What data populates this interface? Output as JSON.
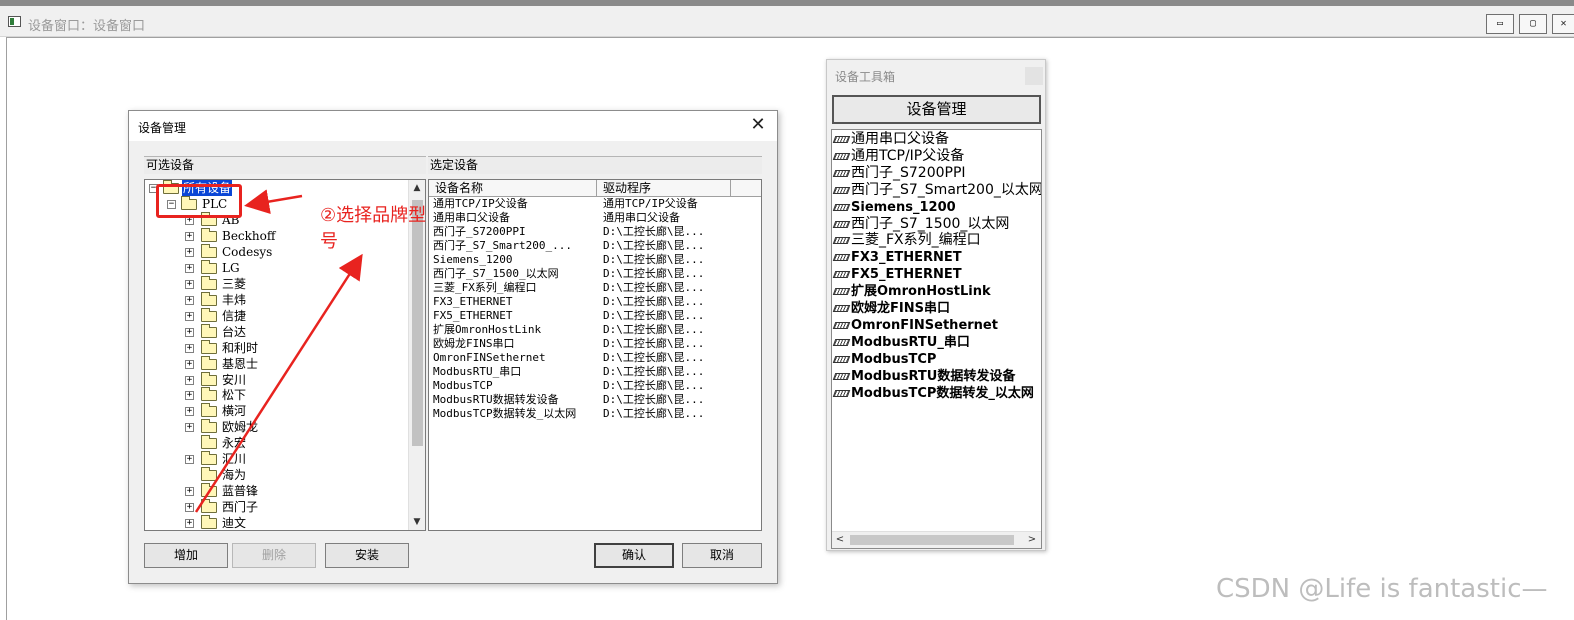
{
  "main_window": {
    "title": "设备窗口：设备窗口",
    "minimize_glyph": "▭",
    "maximize_glyph": "▢",
    "close_glyph": "✕"
  },
  "dialog": {
    "title": "设备管理",
    "close_glyph": "✕",
    "left_panel_header": "可选设备",
    "right_panel_header": "选定设备",
    "tree": {
      "root": "所有设备",
      "plc": "PLC",
      "brands": [
        {
          "label": "AB",
          "expander": "+"
        },
        {
          "label": "Beckhoff",
          "expander": "+"
        },
        {
          "label": "Codesys",
          "expander": "+"
        },
        {
          "label": "LG",
          "expander": "+"
        },
        {
          "label": "三菱",
          "expander": "+"
        },
        {
          "label": "丰炜",
          "expander": "+"
        },
        {
          "label": "信捷",
          "expander": "+"
        },
        {
          "label": "台达",
          "expander": "+"
        },
        {
          "label": "和利时",
          "expander": "+"
        },
        {
          "label": "基恩士",
          "expander": "+"
        },
        {
          "label": "安川",
          "expander": "+"
        },
        {
          "label": "松下",
          "expander": "+"
        },
        {
          "label": "横河",
          "expander": "+"
        },
        {
          "label": "欧姆龙",
          "expander": "+"
        },
        {
          "label": "永宏",
          "expander": ""
        },
        {
          "label": "汇川",
          "expander": "+"
        },
        {
          "label": "海为",
          "expander": ""
        },
        {
          "label": "蓝普锋",
          "expander": "+"
        },
        {
          "label": "西门子",
          "expander": "+"
        },
        {
          "label": "迪文",
          "expander": "+"
        }
      ]
    },
    "list": {
      "columns": [
        "设备名称",
        "驱动程序"
      ],
      "rows": [
        [
          "通用TCP/IP父设备",
          "通用TCP/IP父设备"
        ],
        [
          "通用串口父设备",
          "通用串口父设备"
        ],
        [
          "西门子_S7200PPI",
          "D:\\工控长廊\\昆..."
        ],
        [
          "西门子_S7_Smart200_...",
          "D:\\工控长廊\\昆..."
        ],
        [
          "Siemens_1200",
          "D:\\工控长廊\\昆..."
        ],
        [
          "西门子_S7_1500_以太网",
          "D:\\工控长廊\\昆..."
        ],
        [
          "三菱_FX系列_编程口",
          "D:\\工控长廊\\昆..."
        ],
        [
          "FX3_ETHERNET",
          "D:\\工控长廊\\昆..."
        ],
        [
          "FX5_ETHERNET",
          "D:\\工控长廊\\昆..."
        ],
        [
          "扩展OmronHostLink",
          "D:\\工控长廊\\昆..."
        ],
        [
          "欧姆龙FINS串口",
          "D:\\工控长廊\\昆..."
        ],
        [
          "OmronFINSethernet",
          "D:\\工控长廊\\昆..."
        ],
        [
          "ModbusRTU_串口",
          "D:\\工控长廊\\昆..."
        ],
        [
          "ModbusTCP",
          "D:\\工控长廊\\昆..."
        ],
        [
          "ModbusRTU数据转发设备",
          "D:\\工控长廊\\昆..."
        ],
        [
          "ModbusTCP数据转发_以太网",
          "D:\\工控长廊\\昆..."
        ]
      ]
    },
    "buttons": {
      "add": "增加",
      "delete": "删除",
      "install": "安装",
      "ok": "确认",
      "cancel": "取消"
    }
  },
  "annotation": {
    "text": "②选择品牌型号",
    "color": "#e8231f"
  },
  "toolbox": {
    "title": "设备工具箱",
    "button": "设备管理",
    "items": [
      {
        "label": "通用串口父设备",
        "bold": false
      },
      {
        "label": "通用TCP/IP父设备",
        "bold": false
      },
      {
        "label": "西门子_S7200PPI",
        "bold": false
      },
      {
        "label": "西门子_S7_Smart200_以太网",
        "bold": false
      },
      {
        "label": "Siemens_1200",
        "bold": true
      },
      {
        "label": "西门子_S7_1500_以太网",
        "bold": false
      },
      {
        "label": "三菱_FX系列_编程口",
        "bold": false
      },
      {
        "label": "FX3_ETHERNET",
        "bold": true
      },
      {
        "label": "FX5_ETHERNET",
        "bold": true
      },
      {
        "label": "扩展OmronHostLink",
        "bold": true
      },
      {
        "label": "欧姆龙FINS串口",
        "bold": true
      },
      {
        "label": "OmronFINSethernet",
        "bold": true
      },
      {
        "label": "ModbusRTU_串口",
        "bold": true
      },
      {
        "label": "ModbusTCP",
        "bold": true
      },
      {
        "label": "ModbusRTU数据转发设备",
        "bold": true
      },
      {
        "label": "ModbusTCP数据转发_以太网",
        "bold": true
      }
    ]
  },
  "watermark": "CSDN @Life is fantastic—"
}
